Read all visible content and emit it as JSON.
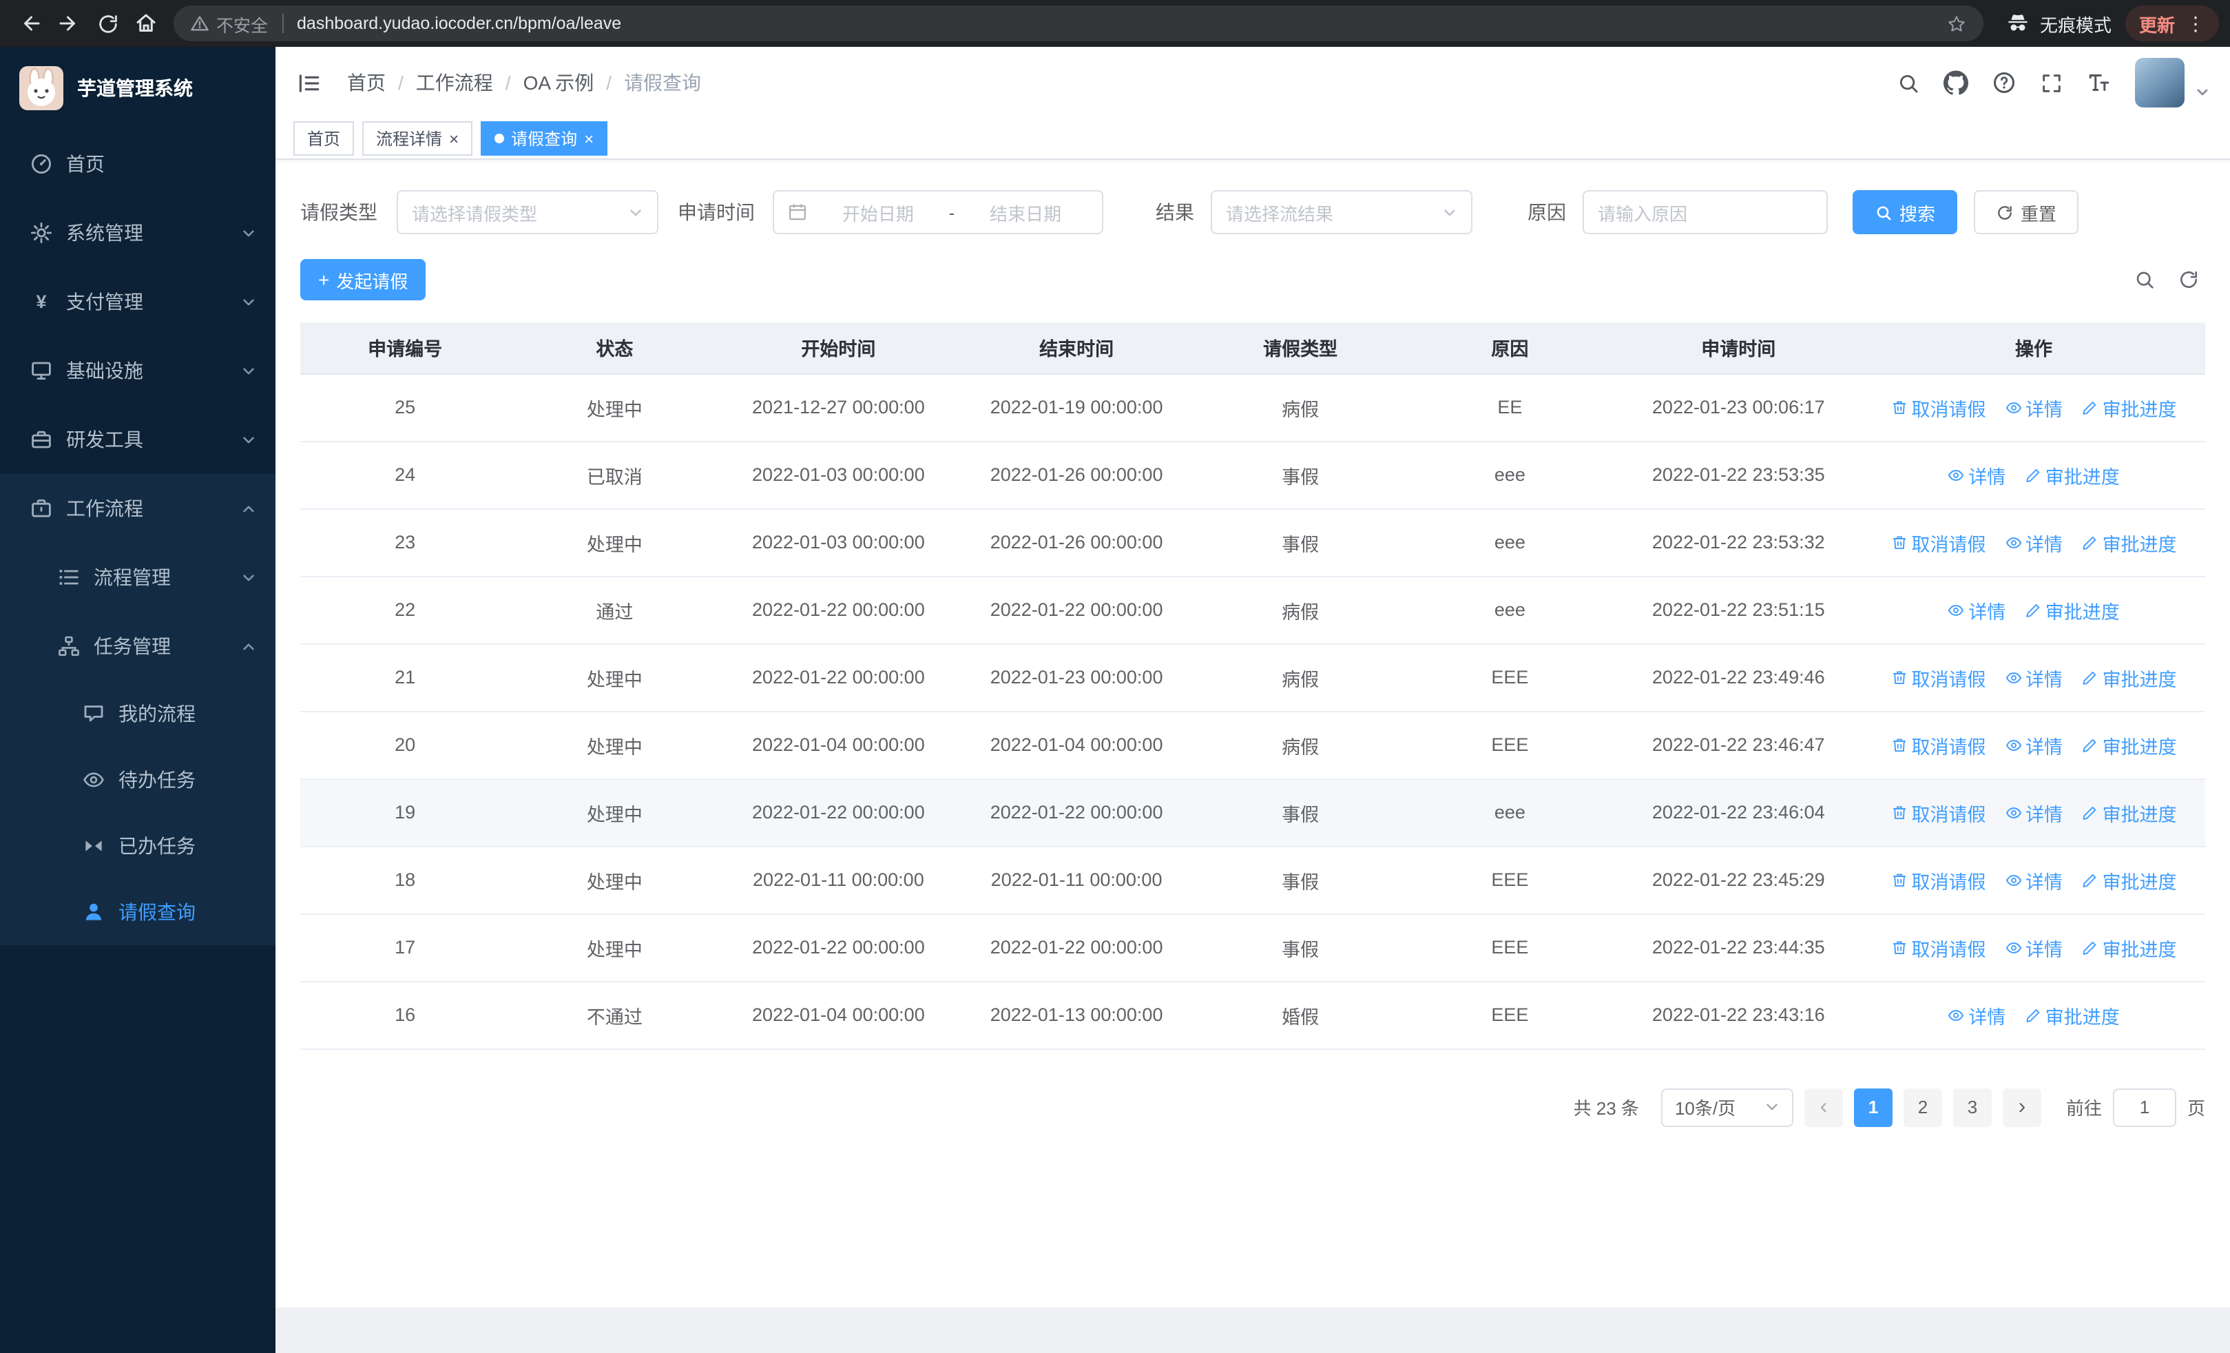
{
  "browser": {
    "security_label": "不安全",
    "url": "dashboard.yudao.iocoder.cn/bpm/oa/leave",
    "incognito_label": "无痕模式",
    "update_label": "更新"
  },
  "icons": {
    "close": "×",
    "plus": "+",
    "kebab": "⋮",
    "prev": "‹",
    "next": "›",
    "breadcrumb_sep": "/"
  },
  "sidebar": {
    "app_title": "芋道管理系统",
    "items": [
      {
        "label": "首页"
      },
      {
        "label": "系统管理"
      },
      {
        "label": "支付管理"
      },
      {
        "label": "基础设施"
      },
      {
        "label": "研发工具"
      },
      {
        "label": "工作流程"
      },
      {
        "label": "流程管理"
      },
      {
        "label": "任务管理"
      },
      {
        "label": "我的流程"
      },
      {
        "label": "待办任务"
      },
      {
        "label": "已办任务"
      },
      {
        "label": "请假查询"
      }
    ]
  },
  "breadcrumb": [
    "首页",
    "工作流程",
    "OA 示例",
    "请假查询"
  ],
  "tabs": [
    {
      "label": "首页"
    },
    {
      "label": "流程详情"
    },
    {
      "label": "请假查询"
    }
  ],
  "filters": {
    "leave_type_label": "请假类型",
    "leave_type_placeholder": "请选择请假类型",
    "apply_time_label": "申请时间",
    "start_date_placeholder": "开始日期",
    "range_separator": "-",
    "end_date_placeholder": "结束日期",
    "result_label": "结果",
    "result_placeholder": "请选择流结果",
    "reason_label": "原因",
    "reason_placeholder": "请输入原因",
    "search_button": "搜索",
    "reset_button": "重置"
  },
  "toolbar": {
    "create_button": "发起请假"
  },
  "table": {
    "columns": [
      "申请编号",
      "状态",
      "开始时间",
      "结束时间",
      "请假类型",
      "原因",
      "申请时间",
      "操作"
    ],
    "actions": {
      "cancel": "取消请假",
      "detail": "详情",
      "progress": "审批进度"
    },
    "rows": [
      {
        "id": "25",
        "status": "处理中",
        "start": "2021-12-27 00:00:00",
        "end": "2022-01-19 00:00:00",
        "type": "病假",
        "reason": "EE",
        "applied": "2022-01-23 00:06:17"
      },
      {
        "id": "24",
        "status": "已取消",
        "start": "2022-01-03 00:00:00",
        "end": "2022-01-26 00:00:00",
        "type": "事假",
        "reason": "eee",
        "applied": "2022-01-22 23:53:35"
      },
      {
        "id": "23",
        "status": "处理中",
        "start": "2022-01-03 00:00:00",
        "end": "2022-01-26 00:00:00",
        "type": "事假",
        "reason": "eee",
        "applied": "2022-01-22 23:53:32"
      },
      {
        "id": "22",
        "status": "通过",
        "start": "2022-01-22 00:00:00",
        "end": "2022-01-22 00:00:00",
        "type": "病假",
        "reason": "eee",
        "applied": "2022-01-22 23:51:15"
      },
      {
        "id": "21",
        "status": "处理中",
        "start": "2022-01-22 00:00:00",
        "end": "2022-01-23 00:00:00",
        "type": "病假",
        "reason": "EEE",
        "applied": "2022-01-22 23:49:46"
      },
      {
        "id": "20",
        "status": "处理中",
        "start": "2022-01-04 00:00:00",
        "end": "2022-01-04 00:00:00",
        "type": "病假",
        "reason": "EEE",
        "applied": "2022-01-22 23:46:47"
      },
      {
        "id": "19",
        "status": "处理中",
        "start": "2022-01-22 00:00:00",
        "end": "2022-01-22 00:00:00",
        "type": "事假",
        "reason": "eee",
        "applied": "2022-01-22 23:46:04"
      },
      {
        "id": "18",
        "status": "处理中",
        "start": "2022-01-11 00:00:00",
        "end": "2022-01-11 00:00:00",
        "type": "事假",
        "reason": "EEE",
        "applied": "2022-01-22 23:45:29"
      },
      {
        "id": "17",
        "status": "处理中",
        "start": "2022-01-22 00:00:00",
        "end": "2022-01-22 00:00:00",
        "type": "事假",
        "reason": "EEE",
        "applied": "2022-01-22 23:44:35"
      },
      {
        "id": "16",
        "status": "不通过",
        "start": "2022-01-04 00:00:00",
        "end": "2022-01-13 00:00:00",
        "type": "婚假",
        "reason": "EEE",
        "applied": "2022-01-22 23:43:16"
      }
    ]
  },
  "pagination": {
    "total": "共 23 条",
    "page_size": "10条/页",
    "pages": [
      "1",
      "2",
      "3"
    ],
    "active_page": "1",
    "goto_label": "前往",
    "goto_value": "1",
    "goto_suffix": "页"
  },
  "colors": {
    "primary": "#409eff"
  }
}
